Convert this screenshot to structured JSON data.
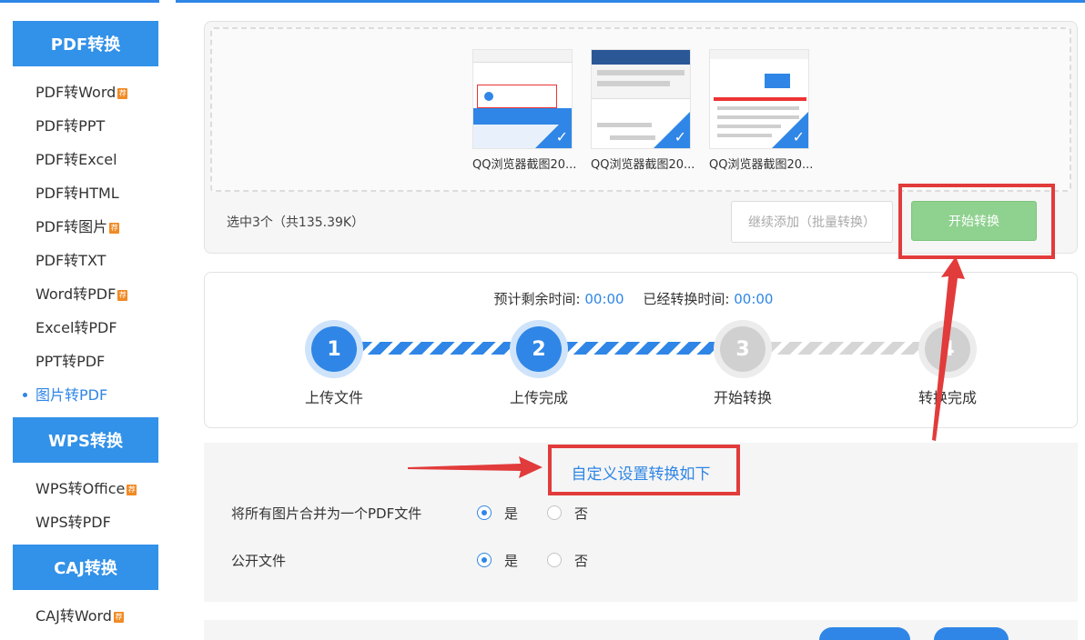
{
  "sidebar": {
    "sections": [
      {
        "title": "PDF转换",
        "items": [
          {
            "label": "PDF转Word",
            "hot": true
          },
          {
            "label": "PDF转PPT",
            "hot": false
          },
          {
            "label": "PDF转Excel",
            "hot": false
          },
          {
            "label": "PDF转HTML",
            "hot": false
          },
          {
            "label": "PDF转图片",
            "hot": true
          },
          {
            "label": "PDF转TXT",
            "hot": false
          },
          {
            "label": "Word转PDF",
            "hot": true
          },
          {
            "label": "Excel转PDF",
            "hot": false
          },
          {
            "label": "PPT转PDF",
            "hot": false
          },
          {
            "label": "图片转PDF",
            "hot": false,
            "active": true
          }
        ]
      },
      {
        "title": "WPS转换",
        "items": [
          {
            "label": "WPS转Office",
            "hot": true
          },
          {
            "label": "WPS转PDF",
            "hot": false
          }
        ]
      },
      {
        "title": "CAJ转换",
        "items": [
          {
            "label": "CAJ转Word",
            "hot": true
          }
        ]
      }
    ],
    "hot_badge": "荐"
  },
  "upload": {
    "files": [
      {
        "name": "QQ浏览器截图20..."
      },
      {
        "name": "QQ浏览器截图20..."
      },
      {
        "name": "QQ浏览器截图20..."
      }
    ],
    "selection_info": "选中3个（共135.39K）",
    "add_button": "继续添加（批量转换）",
    "start_button": "开始转换"
  },
  "progress": {
    "remaining_label": "预计剩余时间:",
    "remaining_value": "00:00",
    "elapsed_label": "已经转换时间:",
    "elapsed_value": "00:00",
    "steps": [
      {
        "num": "1",
        "label": "上传文件",
        "state": "done"
      },
      {
        "num": "2",
        "label": "上传完成",
        "state": "done"
      },
      {
        "num": "3",
        "label": "开始转换",
        "state": "todo"
      },
      {
        "num": "4",
        "label": "转换完成",
        "state": "todo"
      }
    ]
  },
  "settings": {
    "title": "自定义设置转换如下",
    "options": [
      {
        "label": "将所有图片合并为一个PDF文件",
        "yes": "是",
        "no": "否",
        "selected": "yes"
      },
      {
        "label": "公开文件",
        "yes": "是",
        "no": "否",
        "selected": "yes"
      }
    ]
  },
  "colors": {
    "accent": "#2f86e6",
    "start_button": "#8fd18f",
    "annotation_red": "#e23b3b"
  }
}
